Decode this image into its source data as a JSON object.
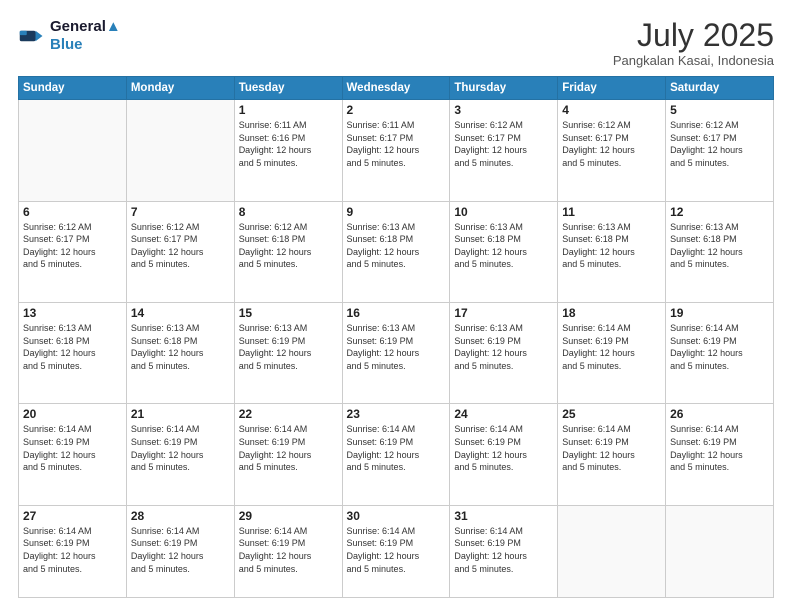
{
  "header": {
    "logo_line1": "General",
    "logo_line2": "Blue",
    "month_year": "July 2025",
    "location": "Pangkalan Kasai, Indonesia"
  },
  "days_of_week": [
    "Sunday",
    "Monday",
    "Tuesday",
    "Wednesday",
    "Thursday",
    "Friday",
    "Saturday"
  ],
  "weeks": [
    [
      {
        "day": "",
        "info": ""
      },
      {
        "day": "",
        "info": ""
      },
      {
        "day": "1",
        "info": "Sunrise: 6:11 AM\nSunset: 6:16 PM\nDaylight: 12 hours\nand 5 minutes."
      },
      {
        "day": "2",
        "info": "Sunrise: 6:11 AM\nSunset: 6:17 PM\nDaylight: 12 hours\nand 5 minutes."
      },
      {
        "day": "3",
        "info": "Sunrise: 6:12 AM\nSunset: 6:17 PM\nDaylight: 12 hours\nand 5 minutes."
      },
      {
        "day": "4",
        "info": "Sunrise: 6:12 AM\nSunset: 6:17 PM\nDaylight: 12 hours\nand 5 minutes."
      },
      {
        "day": "5",
        "info": "Sunrise: 6:12 AM\nSunset: 6:17 PM\nDaylight: 12 hours\nand 5 minutes."
      }
    ],
    [
      {
        "day": "6",
        "info": "Sunrise: 6:12 AM\nSunset: 6:17 PM\nDaylight: 12 hours\nand 5 minutes."
      },
      {
        "day": "7",
        "info": "Sunrise: 6:12 AM\nSunset: 6:17 PM\nDaylight: 12 hours\nand 5 minutes."
      },
      {
        "day": "8",
        "info": "Sunrise: 6:12 AM\nSunset: 6:18 PM\nDaylight: 12 hours\nand 5 minutes."
      },
      {
        "day": "9",
        "info": "Sunrise: 6:13 AM\nSunset: 6:18 PM\nDaylight: 12 hours\nand 5 minutes."
      },
      {
        "day": "10",
        "info": "Sunrise: 6:13 AM\nSunset: 6:18 PM\nDaylight: 12 hours\nand 5 minutes."
      },
      {
        "day": "11",
        "info": "Sunrise: 6:13 AM\nSunset: 6:18 PM\nDaylight: 12 hours\nand 5 minutes."
      },
      {
        "day": "12",
        "info": "Sunrise: 6:13 AM\nSunset: 6:18 PM\nDaylight: 12 hours\nand 5 minutes."
      }
    ],
    [
      {
        "day": "13",
        "info": "Sunrise: 6:13 AM\nSunset: 6:18 PM\nDaylight: 12 hours\nand 5 minutes."
      },
      {
        "day": "14",
        "info": "Sunrise: 6:13 AM\nSunset: 6:18 PM\nDaylight: 12 hours\nand 5 minutes."
      },
      {
        "day": "15",
        "info": "Sunrise: 6:13 AM\nSunset: 6:19 PM\nDaylight: 12 hours\nand 5 minutes."
      },
      {
        "day": "16",
        "info": "Sunrise: 6:13 AM\nSunset: 6:19 PM\nDaylight: 12 hours\nand 5 minutes."
      },
      {
        "day": "17",
        "info": "Sunrise: 6:13 AM\nSunset: 6:19 PM\nDaylight: 12 hours\nand 5 minutes."
      },
      {
        "day": "18",
        "info": "Sunrise: 6:14 AM\nSunset: 6:19 PM\nDaylight: 12 hours\nand 5 minutes."
      },
      {
        "day": "19",
        "info": "Sunrise: 6:14 AM\nSunset: 6:19 PM\nDaylight: 12 hours\nand 5 minutes."
      }
    ],
    [
      {
        "day": "20",
        "info": "Sunrise: 6:14 AM\nSunset: 6:19 PM\nDaylight: 12 hours\nand 5 minutes."
      },
      {
        "day": "21",
        "info": "Sunrise: 6:14 AM\nSunset: 6:19 PM\nDaylight: 12 hours\nand 5 minutes."
      },
      {
        "day": "22",
        "info": "Sunrise: 6:14 AM\nSunset: 6:19 PM\nDaylight: 12 hours\nand 5 minutes."
      },
      {
        "day": "23",
        "info": "Sunrise: 6:14 AM\nSunset: 6:19 PM\nDaylight: 12 hours\nand 5 minutes."
      },
      {
        "day": "24",
        "info": "Sunrise: 6:14 AM\nSunset: 6:19 PM\nDaylight: 12 hours\nand 5 minutes."
      },
      {
        "day": "25",
        "info": "Sunrise: 6:14 AM\nSunset: 6:19 PM\nDaylight: 12 hours\nand 5 minutes."
      },
      {
        "day": "26",
        "info": "Sunrise: 6:14 AM\nSunset: 6:19 PM\nDaylight: 12 hours\nand 5 minutes."
      }
    ],
    [
      {
        "day": "27",
        "info": "Sunrise: 6:14 AM\nSunset: 6:19 PM\nDaylight: 12 hours\nand 5 minutes."
      },
      {
        "day": "28",
        "info": "Sunrise: 6:14 AM\nSunset: 6:19 PM\nDaylight: 12 hours\nand 5 minutes."
      },
      {
        "day": "29",
        "info": "Sunrise: 6:14 AM\nSunset: 6:19 PM\nDaylight: 12 hours\nand 5 minutes."
      },
      {
        "day": "30",
        "info": "Sunrise: 6:14 AM\nSunset: 6:19 PM\nDaylight: 12 hours\nand 5 minutes."
      },
      {
        "day": "31",
        "info": "Sunrise: 6:14 AM\nSunset: 6:19 PM\nDaylight: 12 hours\nand 5 minutes."
      },
      {
        "day": "",
        "info": ""
      },
      {
        "day": "",
        "info": ""
      }
    ]
  ]
}
